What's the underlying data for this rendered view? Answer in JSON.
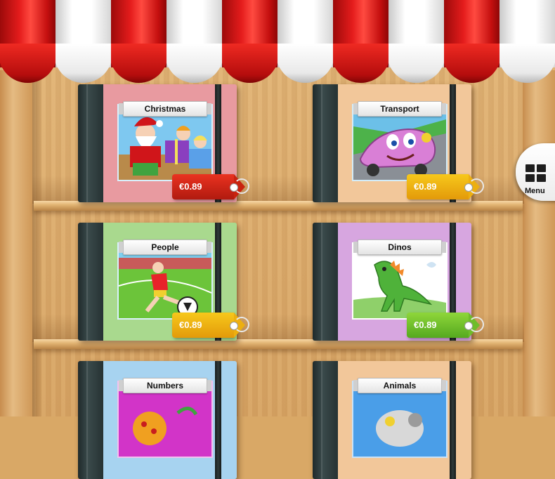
{
  "awning": {
    "stripes": [
      "red",
      "white",
      "red",
      "white",
      "red",
      "white",
      "red",
      "white",
      "red",
      "white"
    ]
  },
  "menu": {
    "label": "Menu",
    "icon": "grid-icon"
  },
  "books": [
    {
      "title": "Christmas",
      "price": "€0.89",
      "tag_color": "red",
      "cover_color": "#e89aa0",
      "art": "christmas"
    },
    {
      "title": "Transport",
      "price": "€0.89",
      "tag_color": "yellow",
      "cover_color": "#f2c79a",
      "art": "transport"
    },
    {
      "title": "People",
      "price": "€0.89",
      "tag_color": "yellow",
      "cover_color": "#a9d98e",
      "art": "people"
    },
    {
      "title": "Dinos",
      "price": "€0.89",
      "tag_color": "green",
      "cover_color": "#d7a6e0",
      "art": "dinos"
    },
    {
      "title": "Numbers",
      "price": "",
      "tag_color": "",
      "cover_color": "#a7d3f0",
      "art": "numbers"
    },
    {
      "title": "Animals",
      "price": "",
      "tag_color": "",
      "cover_color": "#f2c79a",
      "art": "animals"
    }
  ]
}
